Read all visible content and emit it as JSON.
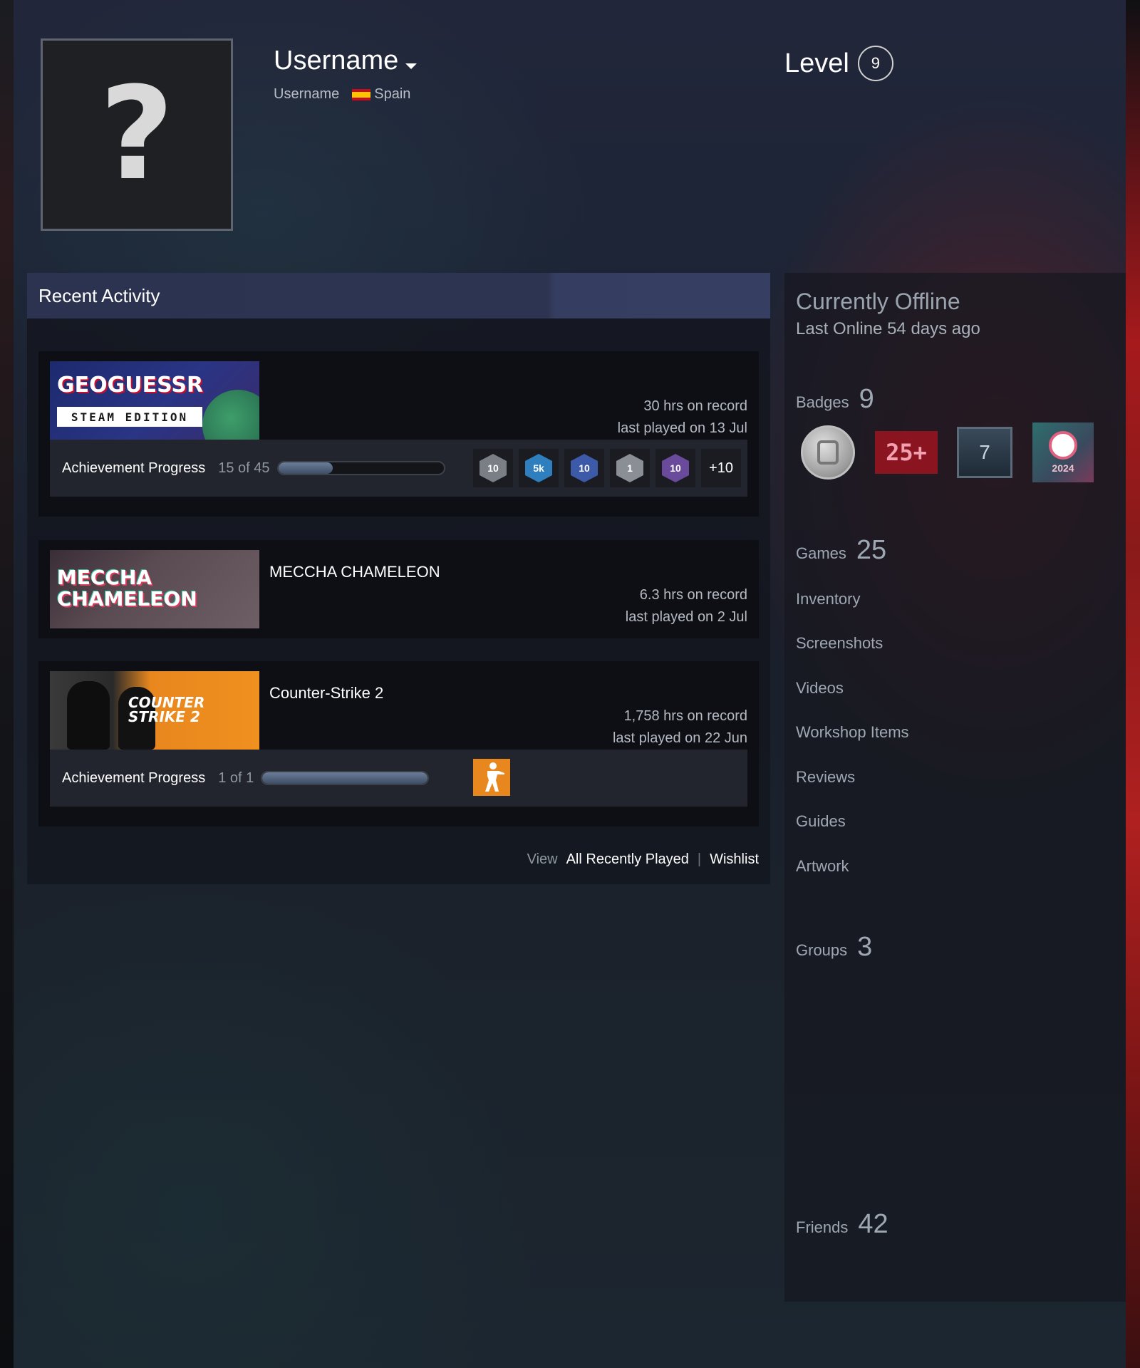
{
  "profile": {
    "persona_name": "Username",
    "account_name": "Username",
    "country": "Spain",
    "level_label": "Level",
    "level": "9"
  },
  "activity": {
    "title": "Recent Activity",
    "games": [
      {
        "name": "",
        "capsule_text": "GEOGUESSR",
        "capsule_sub": "STEAM EDITION",
        "hours": "30 hrs on record",
        "last_played": "last played on 13 Jul",
        "ach_label": "Achievement Progress",
        "ach_count": "15 of 45",
        "ach_progress": 0.33,
        "ach_icons": [
          "10",
          "5k",
          "10",
          "1",
          "10"
        ],
        "ach_more": "+10"
      },
      {
        "name": "MECCHA CHAMELEON",
        "capsule_text": "MECCHA CHAMELEON",
        "hours": "6.3 hrs on record",
        "last_played": "last played on 2 Jul"
      },
      {
        "name": "Counter-Strike 2",
        "capsule_text": "COUNTER STRIKE 2",
        "hours": "1,758 hrs on record",
        "last_played": "last played on 22 Jun",
        "ach_label": "Achievement Progress",
        "ach_count": "1 of 1",
        "ach_progress": 1.0
      }
    ],
    "view_label": "View",
    "all_recently_played": "All Recently Played",
    "wishlist": "Wishlist"
  },
  "sidebar": {
    "status_title": "Currently Offline",
    "last_online": "Last Online 54 days ago",
    "badges_label": "Badges",
    "badges_count": "9",
    "badge_25_text": "25+",
    "badge_7_text": "7",
    "badge_2024_text": "2024",
    "games_label": "Games",
    "games_count": "25",
    "links": [
      "Inventory",
      "Screenshots",
      "Videos",
      "Workshop Items",
      "Reviews",
      "Guides",
      "Artwork"
    ],
    "groups_label": "Groups",
    "groups_count": "3",
    "friends_label": "Friends",
    "friends_count": "42"
  },
  "colors": {
    "accent_red": "#a61a1c",
    "header_bar": "#2c3350",
    "progress_fill": "#5a6b86"
  }
}
